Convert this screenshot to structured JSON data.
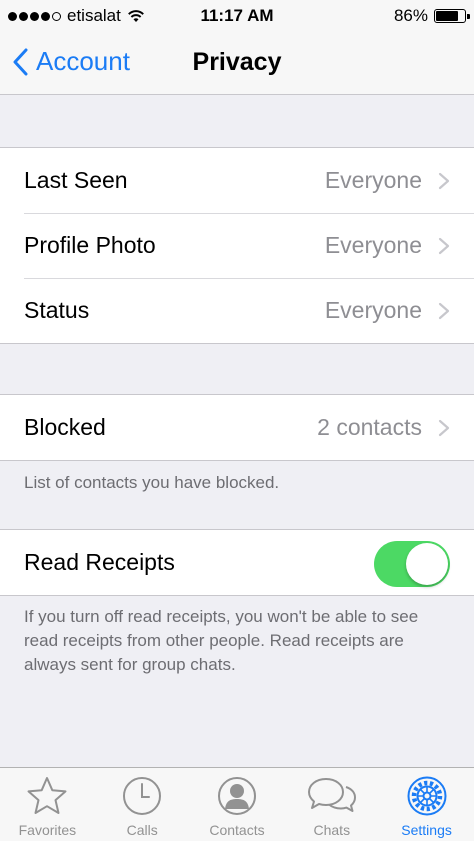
{
  "status_bar": {
    "carrier": "etisalat",
    "time": "11:17 AM",
    "battery": "86%",
    "battery_level": 0.86,
    "signal_bars": 4
  },
  "nav": {
    "back_label": "Account",
    "title": "Privacy"
  },
  "privacy": {
    "rows": [
      {
        "label": "Last Seen",
        "value": "Everyone"
      },
      {
        "label": "Profile Photo",
        "value": "Everyone"
      },
      {
        "label": "Status",
        "value": "Everyone"
      }
    ]
  },
  "blocked": {
    "label": "Blocked",
    "value": "2 contacts",
    "footer": "List of contacts you have blocked."
  },
  "read_receipts": {
    "label": "Read Receipts",
    "enabled": true,
    "footer": "If you turn off read receipts, you won't be able to see read receipts from other people. Read receipts are always sent for group chats."
  },
  "tabbar": {
    "items": [
      {
        "label": "Favorites",
        "icon": "star-icon"
      },
      {
        "label": "Calls",
        "icon": "clock-icon"
      },
      {
        "label": "Contacts",
        "icon": "person-icon"
      },
      {
        "label": "Chats",
        "icon": "chat-bubbles-icon"
      },
      {
        "label": "Settings",
        "icon": "gear-icon",
        "active": true
      }
    ]
  },
  "colors": {
    "accent": "#1b7cf5",
    "toggle_on": "#4cd964",
    "background": "#efeff4",
    "secondary_text": "#8e8e93"
  }
}
